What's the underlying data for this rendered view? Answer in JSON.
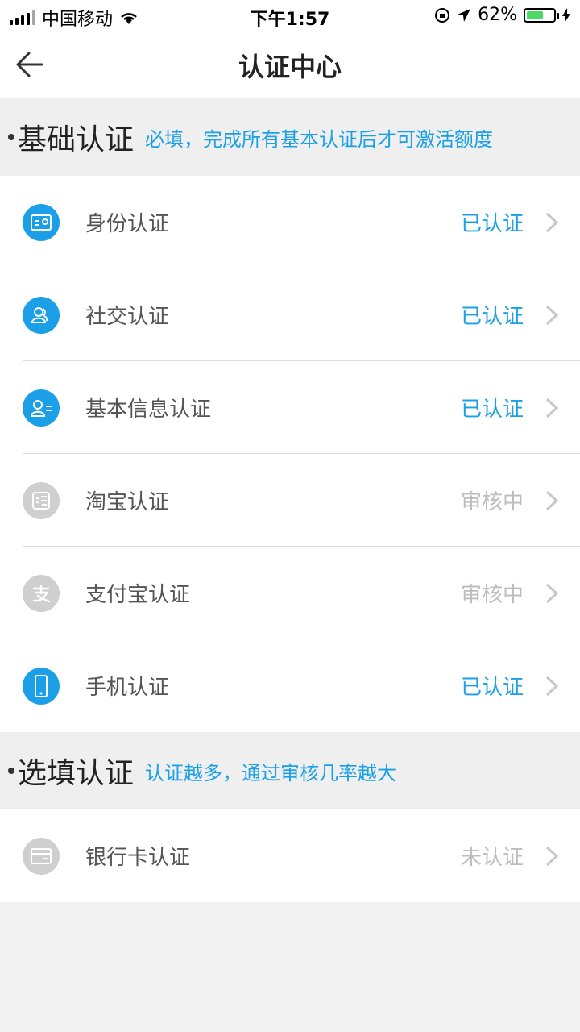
{
  "status_bar": {
    "carrier": "中国移动",
    "time": "下午1:57",
    "battery": "62%"
  },
  "header": {
    "title": "认证中心"
  },
  "sections": [
    {
      "title": "基础认证",
      "hint": "必填，完成所有基本认证后才可激活额度",
      "items": [
        {
          "label": "身份认证",
          "status": "已认证",
          "icon": "id-card-icon",
          "state": "done"
        },
        {
          "label": "社交认证",
          "status": "已认证",
          "icon": "contacts-icon",
          "state": "done"
        },
        {
          "label": "基本信息认证",
          "status": "已认证",
          "icon": "user-info-icon",
          "state": "done"
        },
        {
          "label": "淘宝认证",
          "status": "审核中",
          "icon": "taobao-icon",
          "state": "pending"
        },
        {
          "label": "支付宝认证",
          "status": "审核中",
          "icon": "alipay-icon",
          "state": "pending"
        },
        {
          "label": "手机认证",
          "status": "已认证",
          "icon": "phone-icon",
          "state": "done"
        }
      ]
    },
    {
      "title": "选填认证",
      "hint": "认证越多，通过审核几率越大",
      "items": [
        {
          "label": "银行卡认证",
          "status": "未认证",
          "icon": "bank-card-icon",
          "state": "pending"
        }
      ]
    }
  ],
  "colors": {
    "accent": "#1ba0e8",
    "muted": "#cfcfcf",
    "pending_text": "#bdbdbd"
  }
}
